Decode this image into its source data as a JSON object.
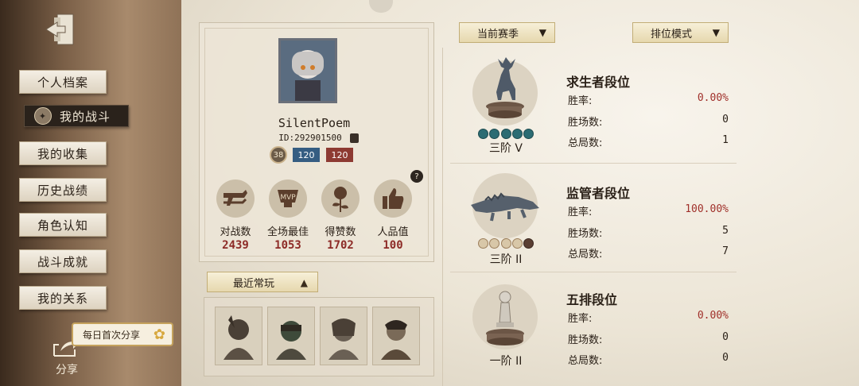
{
  "sidebar": {
    "items": [
      {
        "label": "个人档案"
      },
      {
        "label": "我的战斗"
      },
      {
        "label": "我的收集"
      },
      {
        "label": "历史战绩"
      },
      {
        "label": "角色认知"
      },
      {
        "label": "战斗成就"
      },
      {
        "label": "我的关系"
      }
    ],
    "active_index": 1,
    "share_label": "分享",
    "share_bubble": "每日首次分享"
  },
  "profile": {
    "username": "SilentPoem",
    "id": "ID:292901500",
    "level": "38",
    "rank_blue": "120",
    "rank_red": "120",
    "help_glyph": "?"
  },
  "stats": [
    {
      "label": "对战数",
      "value": "2439",
      "icon": "crossed-guns-icon"
    },
    {
      "label": "全场最佳",
      "value": "1053",
      "icon": "mvp-trophy-icon"
    },
    {
      "label": "得赞数",
      "value": "1702",
      "icon": "rose-icon"
    },
    {
      "label": "人品值",
      "value": "100",
      "icon": "thumbs-up-icon"
    }
  ],
  "recent": {
    "label": "最近常玩",
    "characters": [
      "character-1",
      "character-2",
      "character-3",
      "character-4"
    ]
  },
  "filters": {
    "season": "当前赛季",
    "mode": "排位模式"
  },
  "rankings": [
    {
      "title": "求生者段位",
      "tier": "三阶 V",
      "stars": [
        "teal",
        "teal",
        "teal",
        "teal",
        "teal"
      ],
      "rows": [
        {
          "label": "胜率:",
          "value": "0.00%",
          "highlight": true
        },
        {
          "label": "胜场数:",
          "value": "0",
          "highlight": false
        },
        {
          "label": "总局数:",
          "value": "1",
          "highlight": false
        }
      ]
    },
    {
      "title": "监管者段位",
      "tier": "三阶 II",
      "stars": [
        "tan",
        "tan",
        "tan",
        "tan",
        "dark"
      ],
      "rows": [
        {
          "label": "胜率:",
          "value": "100.00%",
          "highlight": true
        },
        {
          "label": "胜场数:",
          "value": "5",
          "highlight": false
        },
        {
          "label": "总局数:",
          "value": "7",
          "highlight": false
        }
      ]
    },
    {
      "title": "五排段位",
      "tier": "一阶 II",
      "stars": [],
      "rows": [
        {
          "label": "胜率:",
          "value": "0.00%",
          "highlight": true
        },
        {
          "label": "胜场数:",
          "value": "0",
          "highlight": false
        },
        {
          "label": "总局数:",
          "value": "0",
          "highlight": false
        }
      ]
    }
  ],
  "colors": {
    "accent_red": "#a0302a",
    "rank_blue": "#355d82",
    "rank_red": "#8d3a32",
    "parchment": "#ece5d6"
  }
}
